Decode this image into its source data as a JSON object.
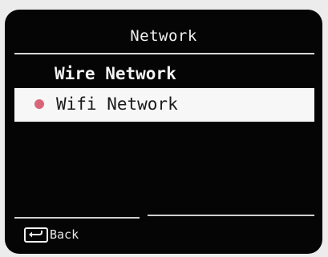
{
  "screen": {
    "title": "Network"
  },
  "menu": {
    "items": [
      {
        "label": "Wire Network",
        "selected": false
      },
      {
        "label": "Wifi Network",
        "selected": true
      }
    ]
  },
  "footer": {
    "back_label": "Back",
    "back_icon": "return-arrow-icon"
  },
  "colors": {
    "screen_bg": "#050505",
    "highlight_bg": "#f7f7f7",
    "selection_dot": "#d96678"
  }
}
